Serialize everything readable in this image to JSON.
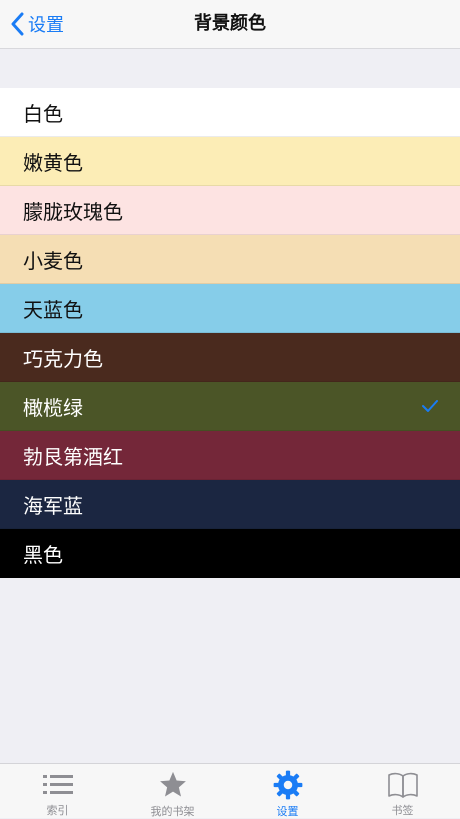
{
  "nav": {
    "back_label": "设置",
    "title": "背景颜色"
  },
  "colors": [
    {
      "label": "白色",
      "bg": "#ffffff",
      "fg": "#111111",
      "selected": false
    },
    {
      "label": "嫩黄色",
      "bg": "#fcedb6",
      "fg": "#111111",
      "selected": false
    },
    {
      "label": "朦胧玫瑰色",
      "bg": "#fde3e2",
      "fg": "#111111",
      "selected": false
    },
    {
      "label": "小麦色",
      "bg": "#f5deb4",
      "fg": "#111111",
      "selected": false
    },
    {
      "label": "天蓝色",
      "bg": "#86cde9",
      "fg": "#111111",
      "selected": false
    },
    {
      "label": "巧克力色",
      "bg": "#4a2a1e",
      "fg": "#ffffff",
      "selected": false
    },
    {
      "label": "橄榄绿",
      "bg": "#4b5527",
      "fg": "#ffffff",
      "selected": true
    },
    {
      "label": "勃艮第酒红",
      "bg": "#742739",
      "fg": "#ffffff",
      "selected": false
    },
    {
      "label": "海军蓝",
      "bg": "#1b2641",
      "fg": "#ffffff",
      "selected": false
    },
    {
      "label": "黑色",
      "bg": "#000000",
      "fg": "#ffffff",
      "selected": false
    }
  ],
  "accent_color": "#1a7cf5",
  "inactive_tab_color": "#8e8e93",
  "tabs": [
    {
      "label": "索引",
      "icon": "list-icon",
      "active": false
    },
    {
      "label": "我的书架",
      "icon": "star-icon",
      "active": false
    },
    {
      "label": "设置",
      "icon": "gear-icon",
      "active": true
    },
    {
      "label": "书签",
      "icon": "book-icon",
      "active": false
    }
  ]
}
